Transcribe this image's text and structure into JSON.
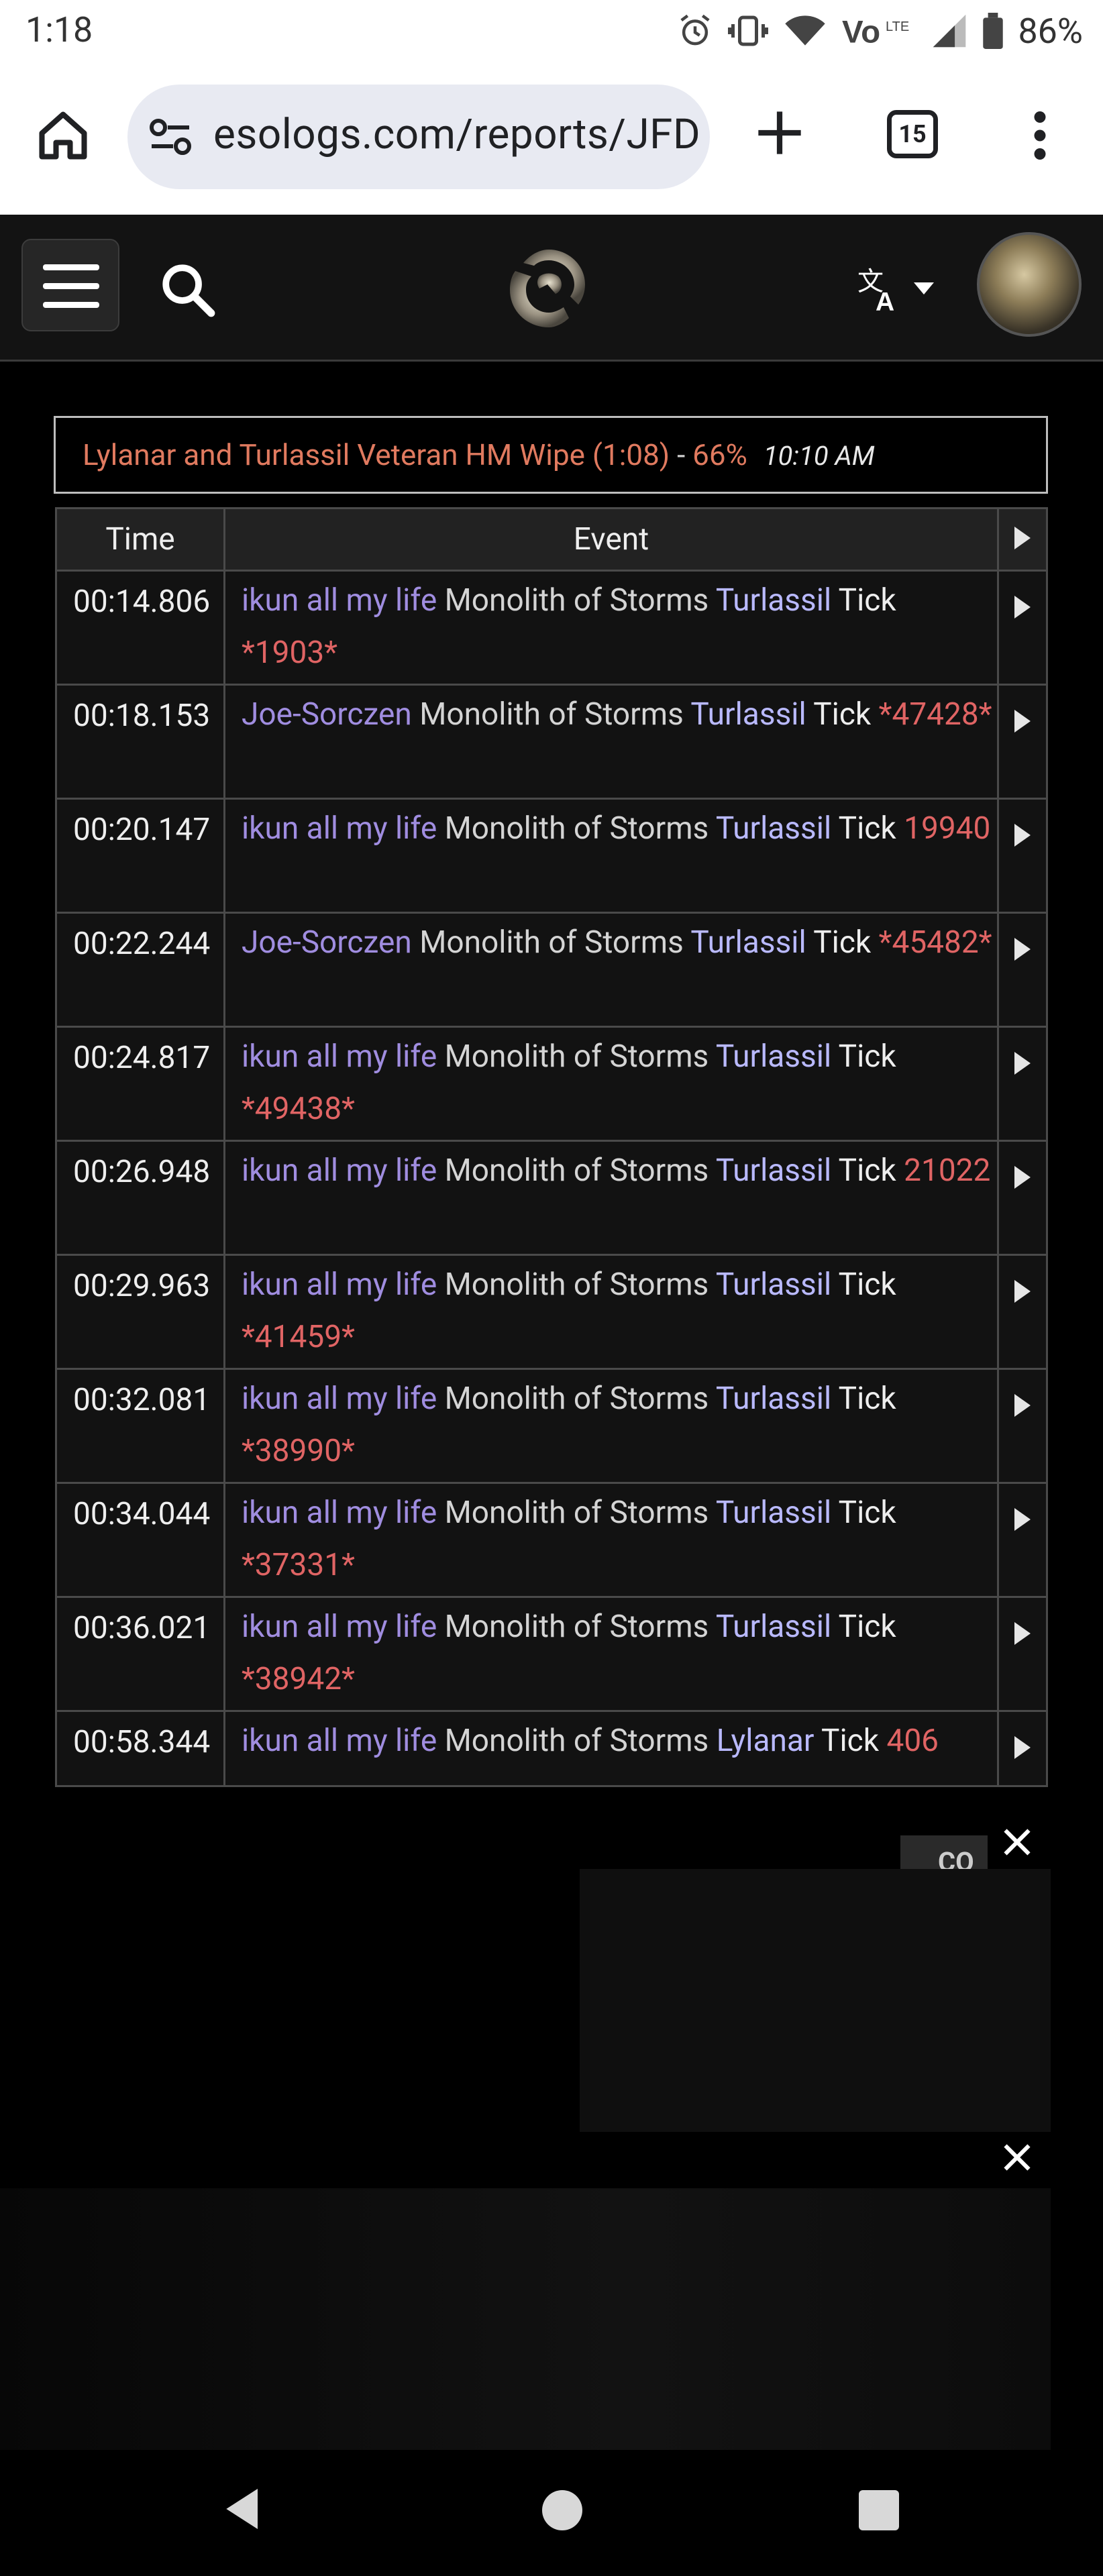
{
  "status_bar": {
    "time": "1:18",
    "battery": "86%"
  },
  "browser": {
    "url": "esologs.com/reports/JFD",
    "tab_count": "15"
  },
  "report": {
    "fight_name": "Lylanar and Turlassil Veteran HM Wipe (1:08)",
    "fight_sep": " - ",
    "fight_percent": "66%",
    "fight_time": "10:10 AM",
    "columns": {
      "time": "Time",
      "event": "Event"
    },
    "events": [
      {
        "time": "00:14.806",
        "source": "ikun all my life",
        "ability": "Monolith of Storms",
        "target": "Turlassil",
        "type": "Tick",
        "amount": "*1903*"
      },
      {
        "time": "00:18.153",
        "source": "Joe-Sorczen",
        "ability": "Monolith of Storms",
        "target": "Turlassil",
        "type": "Tick",
        "amount": "*47428*"
      },
      {
        "time": "00:20.147",
        "source": "ikun all my life",
        "ability": "Monolith of Storms",
        "target": "Turlassil",
        "type": "Tick",
        "amount": "19940"
      },
      {
        "time": "00:22.244",
        "source": "Joe-Sorczen",
        "ability": "Monolith of Storms",
        "target": "Turlassil",
        "type": "Tick",
        "amount": "*45482*"
      },
      {
        "time": "00:24.817",
        "source": "ikun all my life",
        "ability": "Monolith of Storms",
        "target": "Turlassil",
        "type": "Tick",
        "amount": "*49438*"
      },
      {
        "time": "00:26.948",
        "source": "ikun all my life",
        "ability": "Monolith of Storms",
        "target": "Turlassil",
        "type": "Tick",
        "amount": "21022"
      },
      {
        "time": "00:29.963",
        "source": "ikun all my life",
        "ability": "Monolith of Storms",
        "target": "Turlassil",
        "type": "Tick",
        "amount": "*41459*"
      },
      {
        "time": "00:32.081",
        "source": "ikun all my life",
        "ability": "Monolith of Storms",
        "target": "Turlassil",
        "type": "Tick",
        "amount": "*38990*"
      },
      {
        "time": "00:34.044",
        "source": "ikun all my life",
        "ability": "Monolith of Storms",
        "target": "Turlassil",
        "type": "Tick",
        "amount": "*37331*"
      },
      {
        "time": "00:36.021",
        "source": "ikun all my life",
        "ability": "Monolith of Storms",
        "target": "Turlassil",
        "type": "Tick",
        "amount": "*38942*"
      },
      {
        "time": "00:58.344",
        "source": "ikun all my life",
        "ability": "Monolith of Storms",
        "target": "Lylanar",
        "type": "Tick",
        "amount": "406"
      }
    ]
  },
  "icons": [
    "home-icon",
    "tune-icon",
    "plus-icon",
    "tabs-icon",
    "more-vert-icon",
    "menu-icon",
    "search-icon",
    "site-logo",
    "translate-icon",
    "avatar",
    "close-icon",
    "back-icon",
    "home-nav-icon",
    "recents-icon"
  ]
}
